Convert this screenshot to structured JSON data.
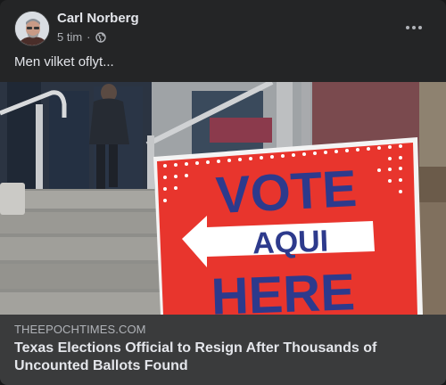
{
  "post": {
    "author": "Carl Norberg",
    "timestamp": "5 tim",
    "separator": "·",
    "audience_icon": "globe-icon",
    "caption": "Men vilket oflyt...",
    "menu_icon": "more-options-icon"
  },
  "photo": {
    "sign_word_1": "VOTE",
    "sign_word_2": "AQUI",
    "sign_word_3": "HERE",
    "sign_red": "#e8352d",
    "sign_navy": "#2d3a8c"
  },
  "link_preview": {
    "domain": "THEEPOCHTIMES.COM",
    "headline": "Texas Elections Official to Resign After Thousands of Uncounted Ballots Found"
  }
}
